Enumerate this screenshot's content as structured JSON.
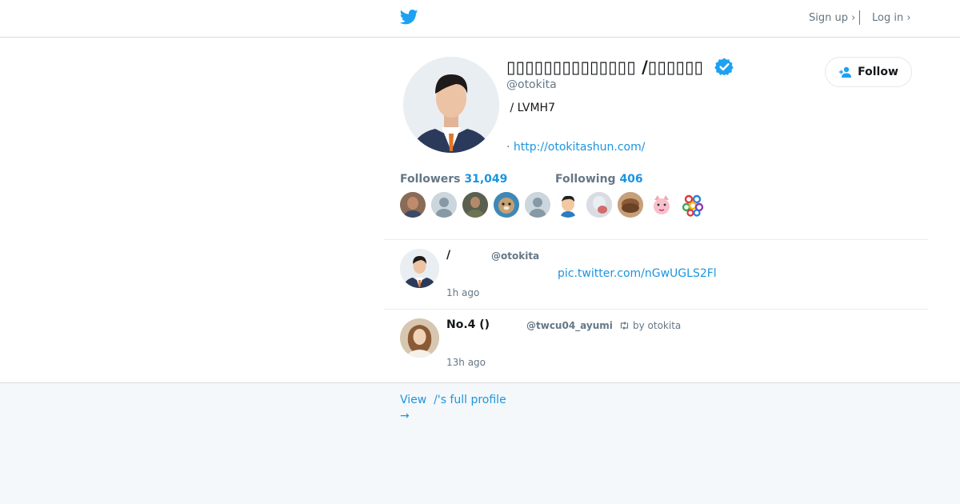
{
  "header": {
    "signup_label": "Sign up ›",
    "login_label": "Log in ›"
  },
  "profile": {
    "display_name": "▯▯▯▯▯▯▯▯▯▯▯▯▯▯ /▯▯▯▯▯▯",
    "handle": "@otokita",
    "bio": " / LVMH7",
    "location_prefix": "· ",
    "url": "http://otokitashun.com/",
    "follow_label": "Follow",
    "verified": true
  },
  "stats": {
    "followers_label": "Followers",
    "followers_count": "31,049",
    "following_label": "Following",
    "following_count": "406"
  },
  "tweets": [
    {
      "name": "/",
      "handle": "@otokita",
      "link": "pic.twitter.com/nGwUGLS2Fl",
      "time": "1h ago"
    },
    {
      "name": "No.4 ()",
      "handle": "@twcu04_ayumi",
      "retweet_label": "by otokita",
      "time": "13h ago"
    }
  ],
  "footer": {
    "view_profile": "View  /'s full profile\n→"
  },
  "colors": {
    "accent": "#1b95e0",
    "verified": "#1da1f2",
    "muted": "#657786"
  }
}
